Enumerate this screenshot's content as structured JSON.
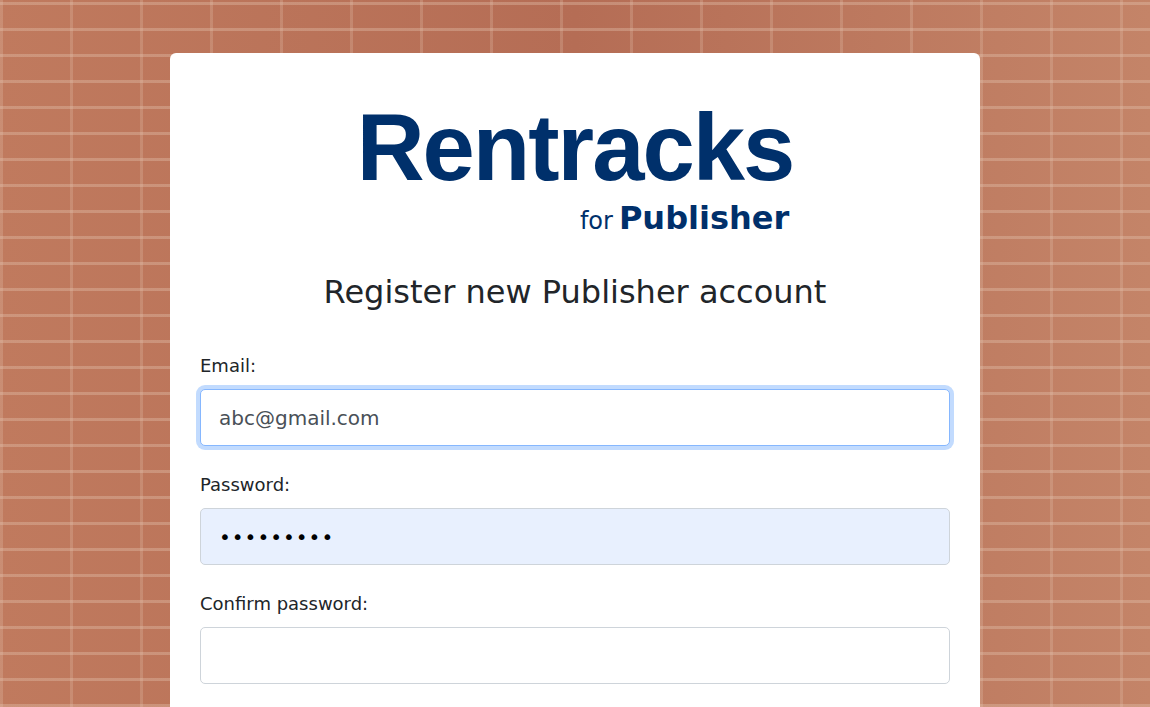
{
  "logo": {
    "name": "Rentracks",
    "tagline_prefix": "for",
    "tagline": "Publisher"
  },
  "heading": "Register new Publisher account",
  "fields": [
    {
      "label": "Email:",
      "value": "abc@gmail.com",
      "focused": true,
      "autofilled": false
    },
    {
      "label": "Password:",
      "value": "•••••••••",
      "focused": false,
      "autofilled": true
    },
    {
      "label": "Confirm password:",
      "value": "",
      "focused": false,
      "autofilled": false
    }
  ]
}
